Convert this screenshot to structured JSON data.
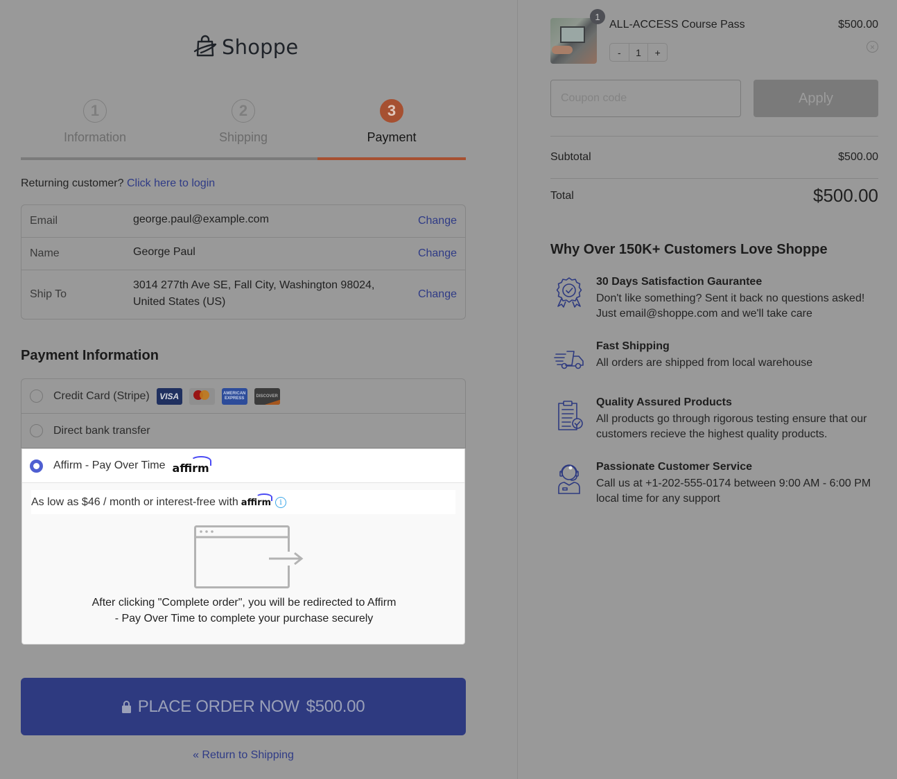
{
  "brand": {
    "name": "Shoppe",
    "accent": "#a65031",
    "primary": "#2e3a80",
    "link": "#2f3b86"
  },
  "steps": [
    {
      "number": "1",
      "label": "Information",
      "state": "done"
    },
    {
      "number": "2",
      "label": "Shipping",
      "state": "done"
    },
    {
      "number": "3",
      "label": "Payment",
      "state": "active"
    }
  ],
  "returning": {
    "prompt": "Returning customer?",
    "link": "Click here to login"
  },
  "customer_info": {
    "rows": [
      {
        "label": "Email",
        "value": "george.paul@example.com",
        "action": "Change"
      },
      {
        "label": "Name",
        "value": "George Paul",
        "action": "Change"
      },
      {
        "label": "Ship To",
        "value": "3014 277th Ave SE, Fall City, Washington 98024, United States (US)",
        "action": "Change"
      }
    ]
  },
  "payment": {
    "heading": "Payment Information",
    "methods": [
      {
        "label": "Credit Card (Stripe)",
        "selected": false,
        "cards": [
          "VISA",
          "mastercard",
          "AMERICAN EXPRESS",
          "DISCOVER"
        ]
      },
      {
        "label": "Direct bank transfer",
        "selected": false
      },
      {
        "label": "Affirm - Pay Over Time",
        "selected": true,
        "logo": "affirm"
      }
    ],
    "affirm": {
      "promo_text": "As low as $46 / month or interest-free with",
      "promo_logo": "affirm",
      "info_icon": "i",
      "redirect_line1": "After clicking \"Complete order\", you will be redirected to Affirm",
      "redirect_line2": "- Pay Over Time to complete your purchase securely"
    }
  },
  "place_order": {
    "label": "PLACE ORDER NOW",
    "amount": "$500.00",
    "icon": "lock-icon"
  },
  "return_link": "« Return to Shipping",
  "cart": {
    "items": [
      {
        "name": "ALL-ACCESS Course Pass",
        "price": "$500.00",
        "quantity": "1",
        "badge": "1",
        "minus": "-",
        "plus": "+",
        "remove": "×"
      }
    ],
    "coupon": {
      "placeholder": "Coupon code",
      "value": "",
      "button": "Apply"
    },
    "subtotal": {
      "label": "Subtotal",
      "value": "$500.00"
    },
    "total": {
      "label": "Total",
      "value": "$500.00"
    }
  },
  "why": {
    "heading": "Why Over 150K+ Customers Love Shoppe",
    "features": [
      {
        "icon": "award-badge-icon",
        "title": "30 Days Satisfaction Gaurantee",
        "description": "Don't like something? Sent it back no questions asked! Just email@shoppe.com and we'll take care"
      },
      {
        "icon": "delivery-truck-icon",
        "title": "Fast Shipping",
        "description": "All orders are shipped from local warehouse"
      },
      {
        "icon": "clipboard-check-icon",
        "title": "Quality Assured Products",
        "description": "All products go through rigorous testing ensure that our customers recieve the highest quality products."
      },
      {
        "icon": "customer-support-icon",
        "title": "Passionate Customer Service",
        "description": "Call us at +1-202-555-0174 between 9:00 AM - 6:00 PM local time for any support"
      }
    ]
  }
}
